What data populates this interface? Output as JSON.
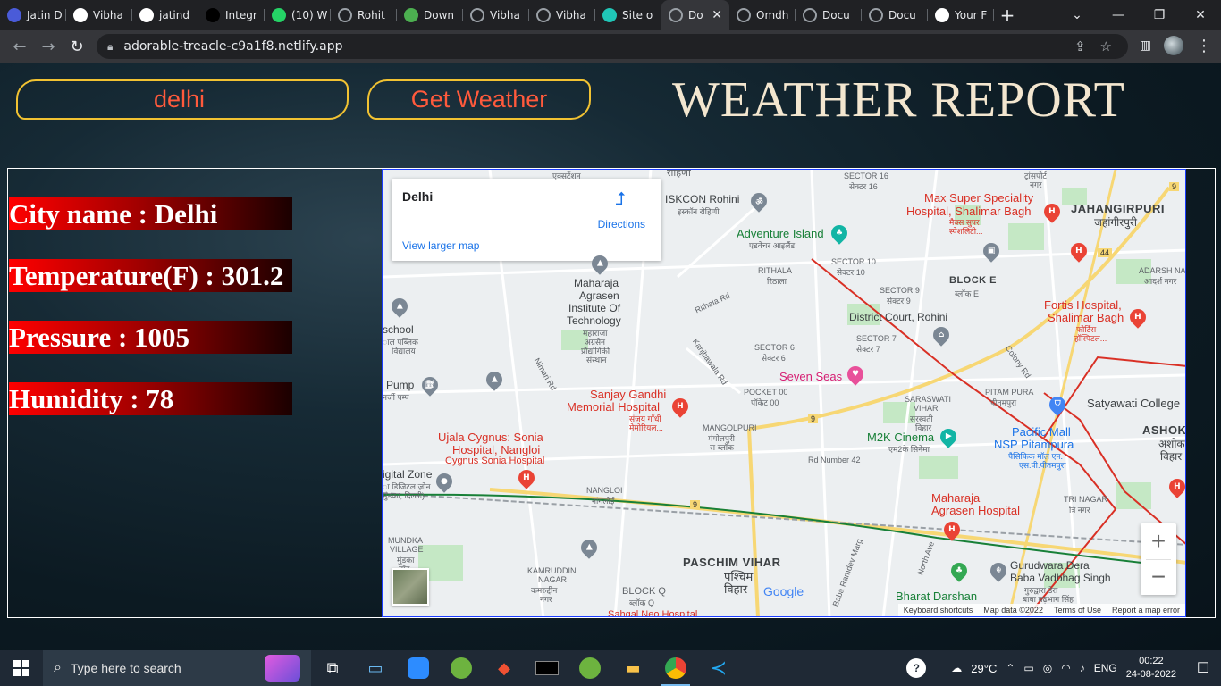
{
  "browser": {
    "tabs": [
      {
        "label": "Jatin D",
        "icon": "jp-icon",
        "color": "#4a5bd8"
      },
      {
        "label": "Vibha",
        "icon": "github-icon",
        "color": "#ffffff"
      },
      {
        "label": "jatind",
        "icon": "github-icon",
        "color": "#ffffff"
      },
      {
        "label": "Integr",
        "icon": "triangle-icon",
        "color": "#000000"
      },
      {
        "label": "(10) W",
        "icon": "whatsapp-icon",
        "color": "#25d366"
      },
      {
        "label": "Rohit",
        "icon": "globe-icon",
        "color": "#9aa0a6"
      },
      {
        "label": "Down",
        "icon": "cube-icon",
        "color": "#4caf50"
      },
      {
        "label": "Vibha",
        "icon": "globe-icon",
        "color": "#9aa0a6"
      },
      {
        "label": "Vibha",
        "icon": "globe-icon",
        "color": "#9aa0a6"
      },
      {
        "label": "Site o",
        "icon": "netlify-icon",
        "color": "#20c6b7"
      },
      {
        "label": "Do",
        "icon": "globe-icon",
        "color": "#9aa0a6",
        "active": true
      },
      {
        "label": "Omdh",
        "icon": "globe-icon",
        "color": "#9aa0a6"
      },
      {
        "label": "Docu",
        "icon": "globe-icon",
        "color": "#9aa0a6"
      },
      {
        "label": "Docu",
        "icon": "globe-icon",
        "color": "#9aa0a6"
      },
      {
        "label": "Your F",
        "icon": "github-icon",
        "color": "#ffffff"
      }
    ],
    "url": "adorable-treacle-c9a1f8.netlify.app"
  },
  "app": {
    "city_value": "delhi",
    "button_label": "Get Weather",
    "title": "WEATHER REPORT",
    "city_line": "City name : Delhi",
    "temp_line": "Temperature(F) : 301.2",
    "pressure_line": "Pressure : 1005",
    "humidity_line": "Humidity : 78",
    "accent": "#ff5a3c",
    "border_color": "#f1c232"
  },
  "map": {
    "card": {
      "title": "Delhi",
      "directions": "Directions",
      "larger": "View larger map"
    },
    "labels": {
      "iskcon": "ISKCON Rohini",
      "iskcon_hi": "इस्कॉन रोहिणी",
      "adventure": "Adventure Island",
      "adventure_hi": "एडवेंचर आइलैंड",
      "sector16": "SECTOR 16",
      "sector16_hi": "सेक्टर 16",
      "max": "Max Super Speciality",
      "max2": "Hospital, Shalimar Bagh",
      "max_hi": "मैक्स सुपर",
      "max_hi2": "स्पेशलिटी...",
      "jahangirpuri": "JAHANGIRPURI",
      "jahangirpuri_hi": "जहांगीरपुरी",
      "maharaja": "Maharaja",
      "maharaja2": "Agrasen",
      "maharaja3": "Institute Of",
      "maharaja4": "Technology",
      "maharaja_hi": "महाराजा",
      "maharaja_hi2": "अग्रसेन",
      "maharaja_hi3": "प्रौद्योगिकी",
      "maharaja_hi4": "संस्थान",
      "rithala": "RITHALA",
      "rithala_hi": "रिठाला",
      "sector10": "SECTOR 10",
      "sector10_hi": "सेक्टर 10",
      "sector9": "SECTOR 9",
      "sector9_hi": "सेक्टर 9",
      "blocke": "BLOCK E",
      "blocke_hi": "ब्लॉक E",
      "adarsh": "ADARSH NAGAR",
      "adarsh_hi": "आदर्श नगर",
      "fortis": "Fortis Hospital,",
      "fortis2": "Shalimar Bagh",
      "fortis_hi": "फोर्टिस",
      "fortis_hi2": "हॉस्पिटल...",
      "district": "District Court, Rohini",
      "school": "school",
      "school2": "ाल पब्लिक",
      "school3": "विद्यालय",
      "rithala_rd": "Rithala Rd",
      "sector6": "SECTOR 6",
      "sector6_hi": "सेक्टर 6",
      "sector7": "SECTOR 7",
      "sector7_hi": "सेक्टर 7",
      "colony_rd": "Colony Rd",
      "sevenseas": "Seven Seas",
      "pump": "Pump",
      "pump_hi": "नर्जी पम्प",
      "nimri": "Nimari Rd",
      "kanjhawala": "Kanjhawala Rd",
      "pocket": "POCKET 00",
      "pocket_hi": "पॉकेट 00",
      "saraswati": "SARASWATI",
      "saraswati2": "VIHAR",
      "saraswati_hi": "सरस्वती",
      "saraswati_hi2": "विहार",
      "pitampura": "PITAM PURA",
      "pitampura_hi": "पीतमपुरा",
      "satyawati": "Satyawati College",
      "sanjay": "Sanjay Gandhi",
      "sanjay2": "Memorial Hospital",
      "sanjay_hi": "संजय गाँधी",
      "sanjay_hi2": "मेमोरियल...",
      "mangolpuri": "MANGOLPURI",
      "mangolpuri_hi": "मंगोलपुरी",
      "mangolpuri_hi2": "स ब्लॉक",
      "m2k": "M2K Cinema",
      "m2k_hi": "एम2के सिनेमा",
      "pacific": "Pacific Mall",
      "pacific2": "NSP Pitampura",
      "pacific_hi": "पैसिफिक मॉल एन.",
      "pacific_hi2": "एस.पी.पीतमपुरा",
      "ashok": "ASHOK V",
      "ashok_hi": "अशोक",
      "ashok_hi2": "विहार",
      "ujala": "Ujala Cygnus: Sonia",
      "ujala2": "Hospital, Nangloi",
      "ujala3": "Cygnus Sonia Hospital",
      "rd42": "Rd Number 42",
      "digital": "igital Zone",
      "digital2": "ा डिजिटल ज़ोन",
      "digital3": "मुंडका, दिल्ली)",
      "nangloi": "NANGLOI",
      "nangloi_hi": "नांगलोई",
      "maharaja_hosp": "Maharaja",
      "maharaja_hosp2": "Agrasen Hospital",
      "trinagar": "TRI NAGAR",
      "trinagar_hi": "त्रि नगर",
      "mundka": "MUNDKA",
      "mundka2": "VILLAGE",
      "mundka_hi": "मुंडका",
      "mundka_hi2": "गाँव",
      "kamruddin": "KAMRUDDIN",
      "kamruddin2": "NAGAR",
      "kamruddin_hi": "कमरुद्दीन",
      "kamruddin_hi2": "नगर",
      "paschim": "PASCHIM VIHAR",
      "paschim_hi": "पश्चिम",
      "paschim_hi2": "विहार",
      "blockq": "BLOCK Q",
      "blockq_hi": "ब्लॉक Q",
      "babaramdev": "Baba Ramdev Marg",
      "northave": "North Ave",
      "gurudwara": "Gurudwara Dera",
      "gurudwara2": "Baba Vadbhag Singh",
      "gurudwara_hi": "गुरुद्वारा डेरा",
      "gurudwara_hi2": "बाबा वढ़भाग सिंह",
      "bharat": "Bharat Darshan",
      "sahgal": "Sahgal Neo Hospital",
      "top1": "एक्सटेंशन",
      "top2": "रोहिणी",
      "sector_top": "ट्रांसपोर्ट",
      "sector_top2": "नगर"
    },
    "road_numbers": [
      "9",
      "44",
      "9",
      "9"
    ],
    "google_logo": "Google",
    "attribution": [
      "Keyboard shortcuts",
      "Map data ©2022",
      "Terms of Use",
      "Report a map error"
    ],
    "zoom_in": "+",
    "zoom_out": "−"
  },
  "taskbar": {
    "search_placeholder": "Type here to search",
    "weather_temp": "29°C",
    "language": "ENG",
    "time": "00:22",
    "date": "24-08-2022"
  }
}
